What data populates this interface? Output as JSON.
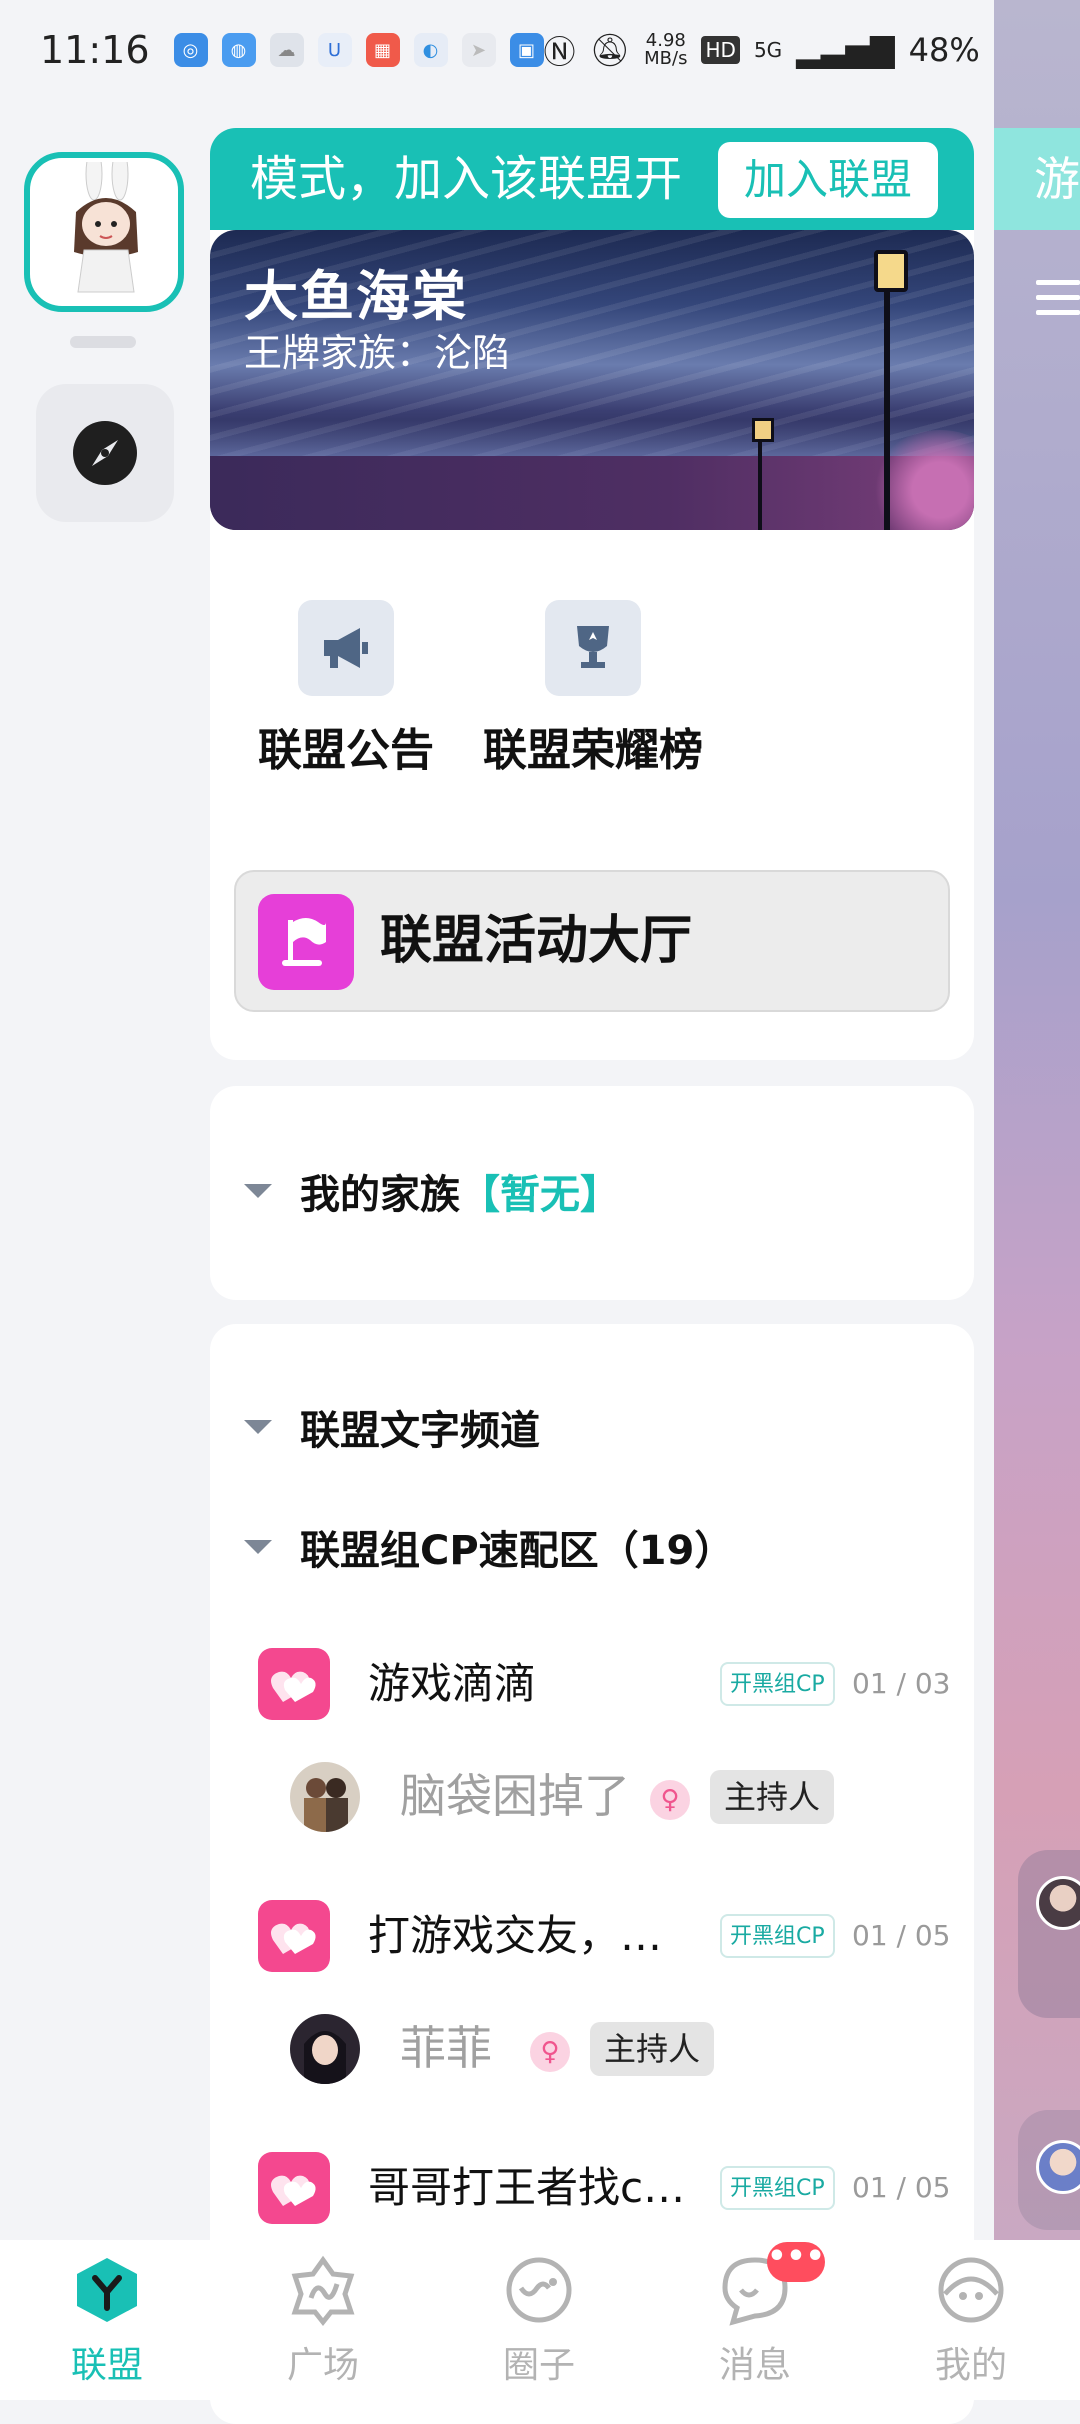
{
  "status_bar": {
    "time": "11:16",
    "net_speed": "4.98",
    "net_speed_unit": "MB/s",
    "hd": "HD",
    "network": "5G",
    "battery": "48%",
    "battery_level": 0.48
  },
  "join_bar": {
    "marquee": "模式，加入该联盟开",
    "button": "加入联盟"
  },
  "peek": {
    "banner_text": "游"
  },
  "alliance": {
    "name": "大鱼海棠",
    "ace_family": "王牌家族：沦陷"
  },
  "quick_actions": [
    {
      "label": "联盟公告",
      "icon": "megaphone-icon"
    },
    {
      "label": "联盟荣耀榜",
      "icon": "trophy-icon"
    }
  ],
  "activity_hall": {
    "label": "联盟活动大厅",
    "icon": "flag-icon"
  },
  "family": {
    "title": "我的家族",
    "status": "【暂无】"
  },
  "channels": {
    "text_channel": "联盟文字频道",
    "cp_zone": "联盟组CP速配区（19）",
    "rooms": [
      {
        "name": "游戏滴滴",
        "tag": "开黑组CP",
        "count": "01 / 03",
        "host": "脑袋困掉了",
        "host_badge": "主持人",
        "gender_symbol": "♀"
      },
      {
        "name": "打游戏交友，…",
        "tag": "开黑组CP",
        "count": "01 / 05",
        "host": "菲菲",
        "host_badge": "主持人",
        "gender_symbol": "♀"
      },
      {
        "name": "哥哥打王者找c…",
        "tag": "开黑组CP",
        "count": "01 / 05"
      }
    ]
  },
  "bottom_nav": [
    {
      "label": "联盟",
      "active": true
    },
    {
      "label": "广场",
      "active": false
    },
    {
      "label": "圈子",
      "active": false
    },
    {
      "label": "消息",
      "active": false,
      "badge": "•••"
    },
    {
      "label": "我的",
      "active": false
    }
  ],
  "colors": {
    "accent": "#19c0b5",
    "hall_icon": "#e63fd8",
    "room_icon": "#f4488f",
    "badge": "#ff4d5e"
  }
}
